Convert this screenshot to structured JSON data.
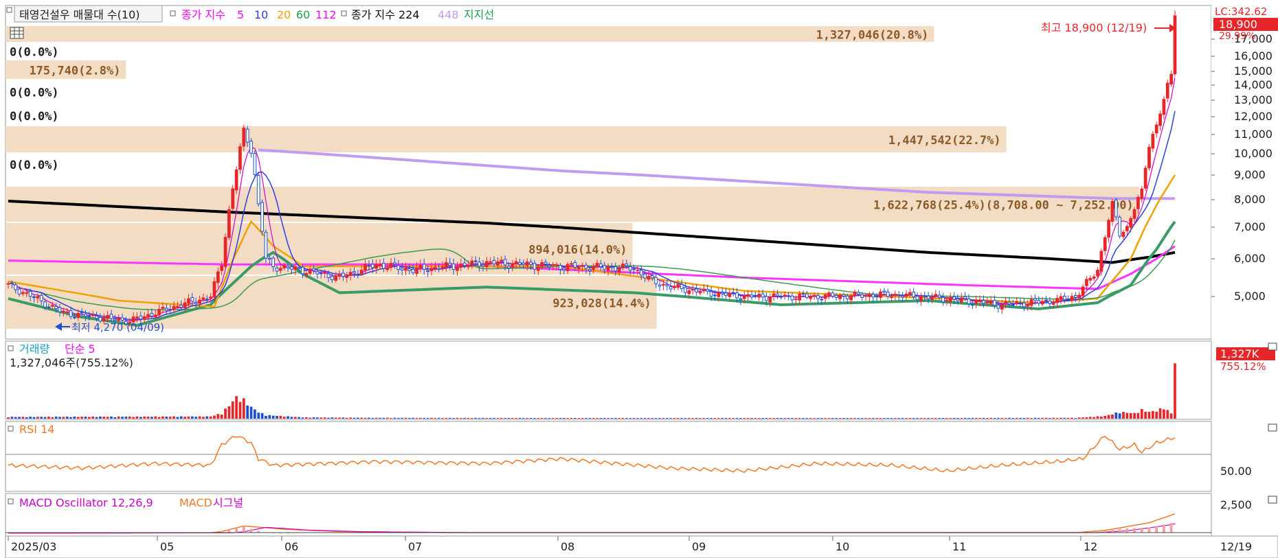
{
  "legend_main": {
    "title_box": "태영건설우 매물대 수(10)",
    "ma_prefix": "종가 지수",
    "ma_items": [
      {
        "label": "5",
        "color": "#ff00ff"
      },
      {
        "label": "10",
        "color": "#2b3fe0"
      },
      {
        "label": "20",
        "color": "#f0a000"
      },
      {
        "label": "60",
        "color": "#1aa050"
      },
      {
        "label": "112",
        "color": "#ff00ff"
      }
    ],
    "ma224_prefix": "종가 지수 224",
    "ma448": "448",
    "support": "지지선"
  },
  "colors": {
    "up": "#e8262a",
    "down": "#1f4fd0",
    "ma5": "#cc00cc",
    "ma10": "#2b3fe0",
    "ma20": "#f0a000",
    "ma60": "#3a9a50",
    "ma112": "#ff33ff",
    "ma224": "#000000",
    "ma448": "#c09cf0",
    "support": "#3a9a68",
    "band": "#f3dcc4",
    "band_text": "#8a5a28",
    "rsi": "#f07828",
    "macd_osc": "#f0a0a0"
  },
  "price_axis": {
    "labels": [
      "17,000",
      "16,000",
      "15,000",
      "14,000",
      "13,000",
      "12,000",
      "11,000",
      "10,000",
      "9,000",
      "8,000",
      "7,000",
      "6,000",
      "5,000"
    ],
    "values": [
      17000,
      16000,
      15000,
      14000,
      13000,
      12000,
      11000,
      10000,
      9000,
      8000,
      7000,
      6000,
      5000
    ],
    "top_lc": "LC:342.62",
    "current_price": "18,900",
    "current_pct": "29.99%"
  },
  "volume_profile": [
    {
      "label": "1,327,046(20.8%)",
      "frac": 0.77
    },
    {
      "label": "175,740(2.8%)",
      "frac": 0.1
    },
    {
      "label": "0(0.0%)",
      "frac": 0
    },
    {
      "label": "0(0.0%)",
      "frac": 0
    },
    {
      "label": "0(0.0%)",
      "frac": 0
    },
    {
      "label": "0(0.0%)",
      "frac": 0
    },
    {
      "label": "1,447,542(22.7%)",
      "frac": 0.83
    },
    {
      "label": "1,622,768(25.4%)(8,708.00 ~ 7,252.00)",
      "frac": 0.94
    },
    {
      "label": "894,016(14.0%)",
      "frac": 0.52
    },
    {
      "label": "923,028(14.4%)",
      "frac": 0.54
    }
  ],
  "annotations": {
    "high": "최고 18,900 (12/19)",
    "low": "최저 4,270 (04/09)"
  },
  "volume_panel": {
    "title": "거래량",
    "ma_label": "단순 5",
    "info": "1,327,046주(755.12%)",
    "badge": "1,327K",
    "badge_pct": "755.12%"
  },
  "rsi_panel": {
    "title": "RSI 14",
    "axis_label": "50.00"
  },
  "macd_panel": {
    "osc_label": "MACD Oscillator 12,26,9",
    "macd_label": "MACD",
    "signal_label": "시그널",
    "axis_label": "2,500"
  },
  "x_axis": {
    "labels": [
      "2025/03",
      "05",
      "06",
      "07",
      "08",
      "09",
      "10",
      "11",
      "12"
    ],
    "right_label": "12/19"
  },
  "chart_data": {
    "type": "candlestick",
    "x_start": "2025-03-04",
    "x_end": "2025-12-19",
    "high": 18900,
    "low": 4270,
    "price_keys": [
      [
        0,
        5300
      ],
      [
        15,
        4600
      ],
      [
        33,
        4400
      ],
      [
        45,
        4750
      ],
      [
        55,
        5000
      ],
      [
        58,
        5900
      ],
      [
        62,
        9300
      ],
      [
        64,
        11200
      ],
      [
        66,
        10200
      ],
      [
        68,
        7800
      ],
      [
        70,
        6000
      ],
      [
        72,
        5800
      ],
      [
        80,
        5700
      ],
      [
        90,
        5500
      ],
      [
        100,
        5850
      ],
      [
        110,
        5700
      ],
      [
        130,
        5900
      ],
      [
        150,
        5800
      ],
      [
        170,
        5750
      ],
      [
        175,
        5400
      ],
      [
        180,
        5250
      ],
      [
        190,
        5100
      ],
      [
        200,
        5000
      ],
      [
        220,
        5000
      ],
      [
        240,
        5050
      ],
      [
        255,
        4950
      ],
      [
        270,
        4800
      ],
      [
        285,
        4900
      ],
      [
        290,
        5000
      ],
      [
        296,
        5700
      ],
      [
        300,
        7800
      ],
      [
        302,
        6800
      ],
      [
        304,
        7000
      ],
      [
        306,
        7700
      ],
      [
        308,
        8300
      ],
      [
        310,
        10500
      ],
      [
        312,
        11500
      ],
      [
        314,
        13000
      ],
      [
        316,
        14800
      ],
      [
        317,
        18900
      ]
    ],
    "volume_keys": [
      [
        0,
        40
      ],
      [
        55,
        50
      ],
      [
        58,
        120
      ],
      [
        60,
        300
      ],
      [
        62,
        480
      ],
      [
        64,
        420
      ],
      [
        66,
        260
      ],
      [
        68,
        150
      ],
      [
        70,
        80
      ],
      [
        80,
        30
      ],
      [
        100,
        20
      ],
      [
        200,
        10
      ],
      [
        290,
        20
      ],
      [
        298,
        60
      ],
      [
        302,
        150
      ],
      [
        306,
        120
      ],
      [
        308,
        200
      ],
      [
        310,
        150
      ],
      [
        312,
        180
      ],
      [
        314,
        250
      ],
      [
        316,
        120
      ],
      [
        317,
        1327
      ]
    ],
    "rsi_keys": [
      [
        0,
        48
      ],
      [
        20,
        45
      ],
      [
        40,
        50
      ],
      [
        55,
        48
      ],
      [
        58,
        70
      ],
      [
        62,
        80
      ],
      [
        66,
        72
      ],
      [
        68,
        55
      ],
      [
        72,
        48
      ],
      [
        100,
        52
      ],
      [
        130,
        50
      ],
      [
        150,
        55
      ],
      [
        180,
        45
      ],
      [
        200,
        42
      ],
      [
        220,
        50
      ],
      [
        240,
        48
      ],
      [
        255,
        42
      ],
      [
        270,
        48
      ],
      [
        285,
        52
      ],
      [
        292,
        55
      ],
      [
        298,
        80
      ],
      [
        302,
        65
      ],
      [
        306,
        70
      ],
      [
        308,
        62
      ],
      [
        312,
        72
      ],
      [
        317,
        78
      ]
    ],
    "macd_keys": [
      [
        0,
        -50
      ],
      [
        55,
        -20
      ],
      [
        58,
        100
      ],
      [
        64,
        600
      ],
      [
        68,
        500
      ],
      [
        75,
        300
      ],
      [
        90,
        100
      ],
      [
        120,
        0
      ],
      [
        200,
        0
      ],
      [
        290,
        0
      ],
      [
        298,
        200
      ],
      [
        305,
        600
      ],
      [
        310,
        900
      ],
      [
        317,
        1700
      ]
    ],
    "ma_curves": {
      "ma224": [
        [
          0,
          7950
        ],
        [
          60,
          7550
        ],
        [
          130,
          7150
        ],
        [
          200,
          6600
        ],
        [
          250,
          6200
        ],
        [
          300,
          5900
        ],
        [
          310,
          6050
        ],
        [
          317,
          6200
        ]
      ],
      "ma448": [
        [
          68,
          10200
        ],
        [
          150,
          9200
        ],
        [
          250,
          8300
        ],
        [
          300,
          8050
        ],
        [
          317,
          8050
        ]
      ],
      "ma112": [
        [
          0,
          5950
        ],
        [
          60,
          5850
        ],
        [
          120,
          5850
        ],
        [
          200,
          5500
        ],
        [
          260,
          5300
        ],
        [
          296,
          5200
        ],
        [
          305,
          5600
        ],
        [
          312,
          6000
        ],
        [
          317,
          6400
        ]
      ],
      "support": [
        [
          0,
          4950
        ],
        [
          20,
          4500
        ],
        [
          35,
          4300
        ],
        [
          55,
          4800
        ],
        [
          66,
          5800
        ],
        [
          72,
          6200
        ],
        [
          80,
          5600
        ],
        [
          90,
          5100
        ],
        [
          130,
          5250
        ],
        [
          170,
          5100
        ],
        [
          210,
          4800
        ],
        [
          250,
          4900
        ],
        [
          280,
          4700
        ],
        [
          296,
          4850
        ],
        [
          305,
          5300
        ],
        [
          312,
          6300
        ],
        [
          317,
          7200
        ]
      ],
      "ma20": [
        [
          0,
          5400
        ],
        [
          30,
          4900
        ],
        [
          56,
          4750
        ],
        [
          62,
          6200
        ],
        [
          66,
          7200
        ],
        [
          72,
          6400
        ],
        [
          80,
          5800
        ],
        [
          150,
          5800
        ],
        [
          200,
          5150
        ],
        [
          280,
          4850
        ],
        [
          296,
          4950
        ],
        [
          305,
          6000
        ],
        [
          312,
          7800
        ],
        [
          317,
          9000
        ]
      ]
    }
  }
}
